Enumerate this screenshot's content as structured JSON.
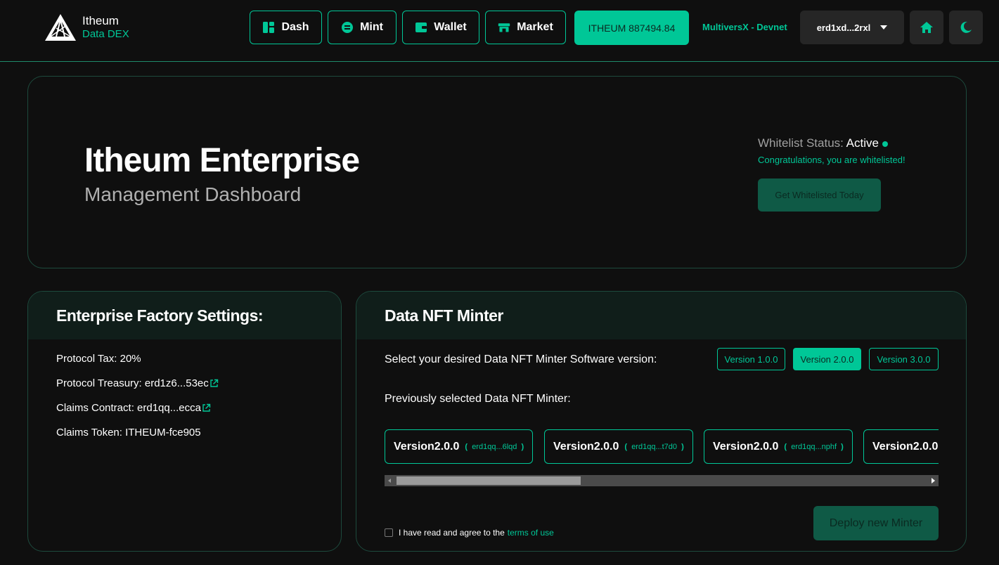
{
  "header": {
    "brand_name": "Itheum",
    "brand_sub": "Data DEX",
    "nav": [
      {
        "label": "Dash",
        "icon": "dashboard-icon"
      },
      {
        "label": "Mint",
        "icon": "mint-icon"
      },
      {
        "label": "Wallet",
        "icon": "wallet-icon"
      },
      {
        "label": "Market",
        "icon": "market-icon"
      }
    ],
    "balance": "ITHEUM 887494.84",
    "network": "MultiversX - Devnet",
    "account": "erd1xd...2rxl",
    "home_icon": "home-icon",
    "theme_icon": "moon-icon"
  },
  "hero": {
    "title": "Itheum Enterprise",
    "subtitle": "Management Dashboard",
    "whitelist_label": "Whitelist Status:",
    "whitelist_value": "Active",
    "whitelist_message": "Congratulations, you are whitelisted!",
    "whitelist_button": "Get Whitelisted Today"
  },
  "factory": {
    "title": "Enterprise Factory Settings:",
    "rows": [
      {
        "text": "Protocol Tax: 20%",
        "link": false
      },
      {
        "text": "Protocol Treasury: erd1z6...53ec",
        "link": true
      },
      {
        "text": "Claims Contract: erd1qq...ecca",
        "link": true
      },
      {
        "text": "Claims Token: ITHEUM-fce905",
        "link": false
      }
    ]
  },
  "minter": {
    "title": "Data NFT Minter",
    "select_label": "Select your desired Data NFT Minter Software version:",
    "versions": [
      "Version 1.0.0",
      "Version 2.0.0",
      "Version 3.0.0"
    ],
    "active_version": "Version 2.0.0",
    "previous_label": "Previously selected Data NFT Minter:",
    "previous": [
      {
        "version": "Version2.0.0",
        "address": "erd1qq...6lqd"
      },
      {
        "version": "Version2.0.0",
        "address": "erd1qq...t7d0"
      },
      {
        "version": "Version2.0.0",
        "address": "erd1qq...nphf"
      },
      {
        "version": "Version2.0.0",
        "address": ""
      }
    ],
    "agree_text": "I have read and agree to the",
    "terms_link": "terms of use",
    "deploy_button": "Deploy new Minter"
  },
  "colors": {
    "accent": "#00c797",
    "background": "#0f0f0f",
    "panel_border": "#1d4a3d",
    "disabled_button": "#0f5a46"
  }
}
